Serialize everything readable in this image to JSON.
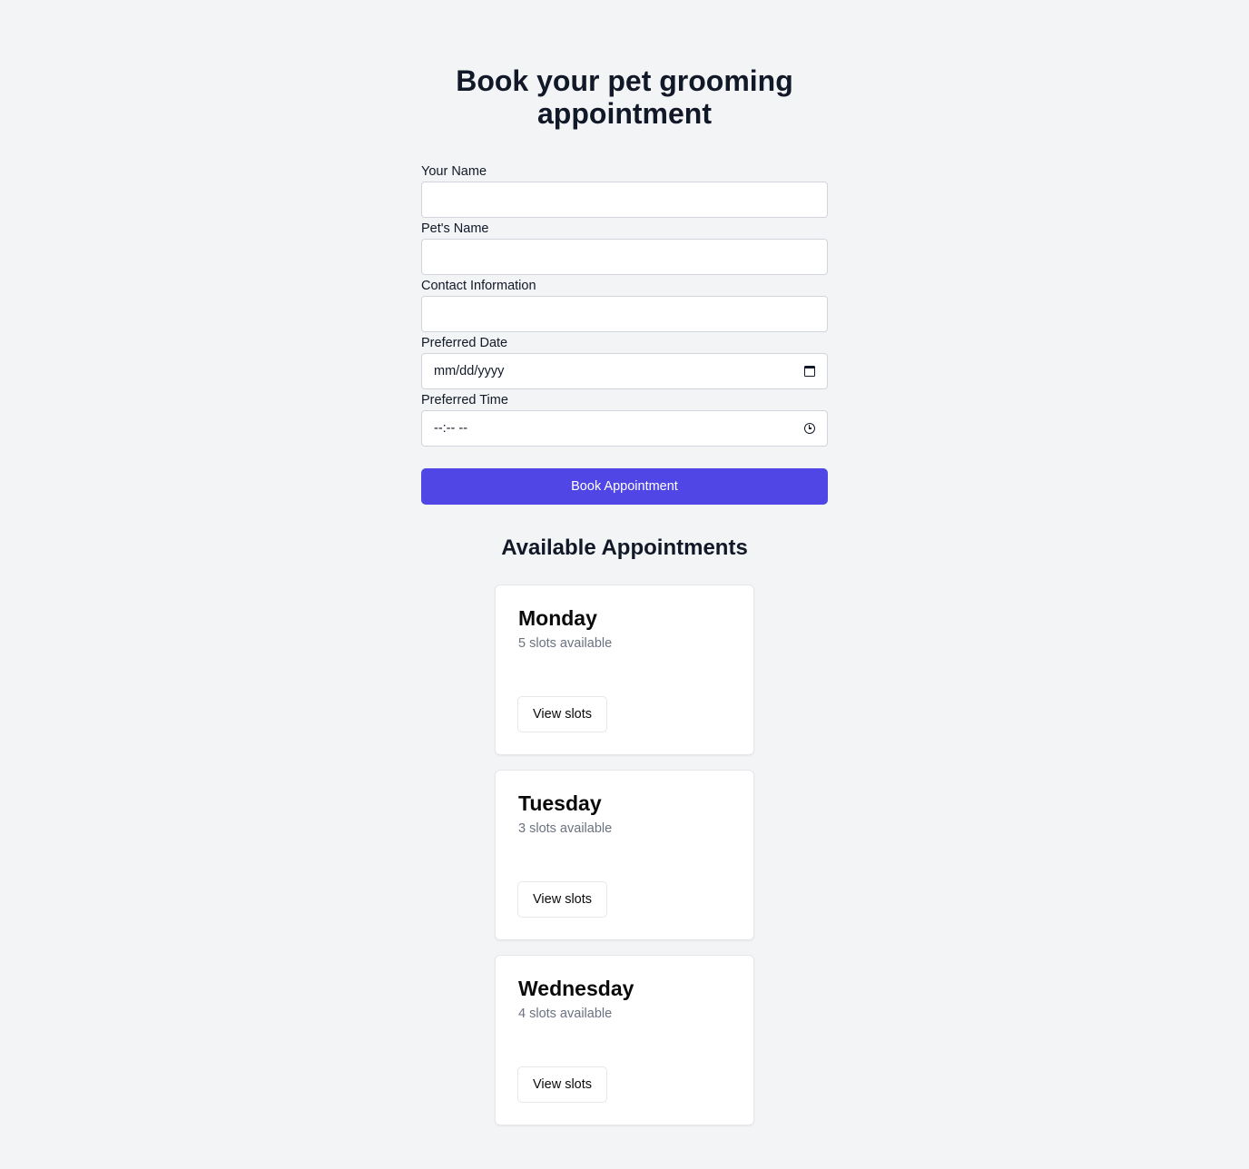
{
  "header": {
    "title_line1": "Book your pet grooming",
    "title_line2": "appointment"
  },
  "form": {
    "fields": [
      {
        "label": "Your Name",
        "value": ""
      },
      {
        "label": "Pet's Name",
        "value": ""
      },
      {
        "label": "Contact Information",
        "value": ""
      },
      {
        "label": "Preferred Date",
        "placeholder": "mm/dd/yyyy",
        "icon": "calendar-icon"
      },
      {
        "label": "Preferred Time",
        "placeholder": "--:-- --",
        "icon": "clock-icon"
      }
    ],
    "submit_label": "Book Appointment"
  },
  "availability": {
    "title": "Available Appointments",
    "days": [
      {
        "day": "Monday",
        "slots": "5 slots available",
        "button": "View slots"
      },
      {
        "day": "Tuesday",
        "slots": "3 slots available",
        "button": "View slots"
      },
      {
        "day": "Wednesday",
        "slots": "4 slots available",
        "button": "View slots"
      }
    ]
  },
  "colors": {
    "background": "#f3f4f6",
    "accent": "#4f46e5",
    "text": "#111827",
    "muted": "#6b7280"
  }
}
